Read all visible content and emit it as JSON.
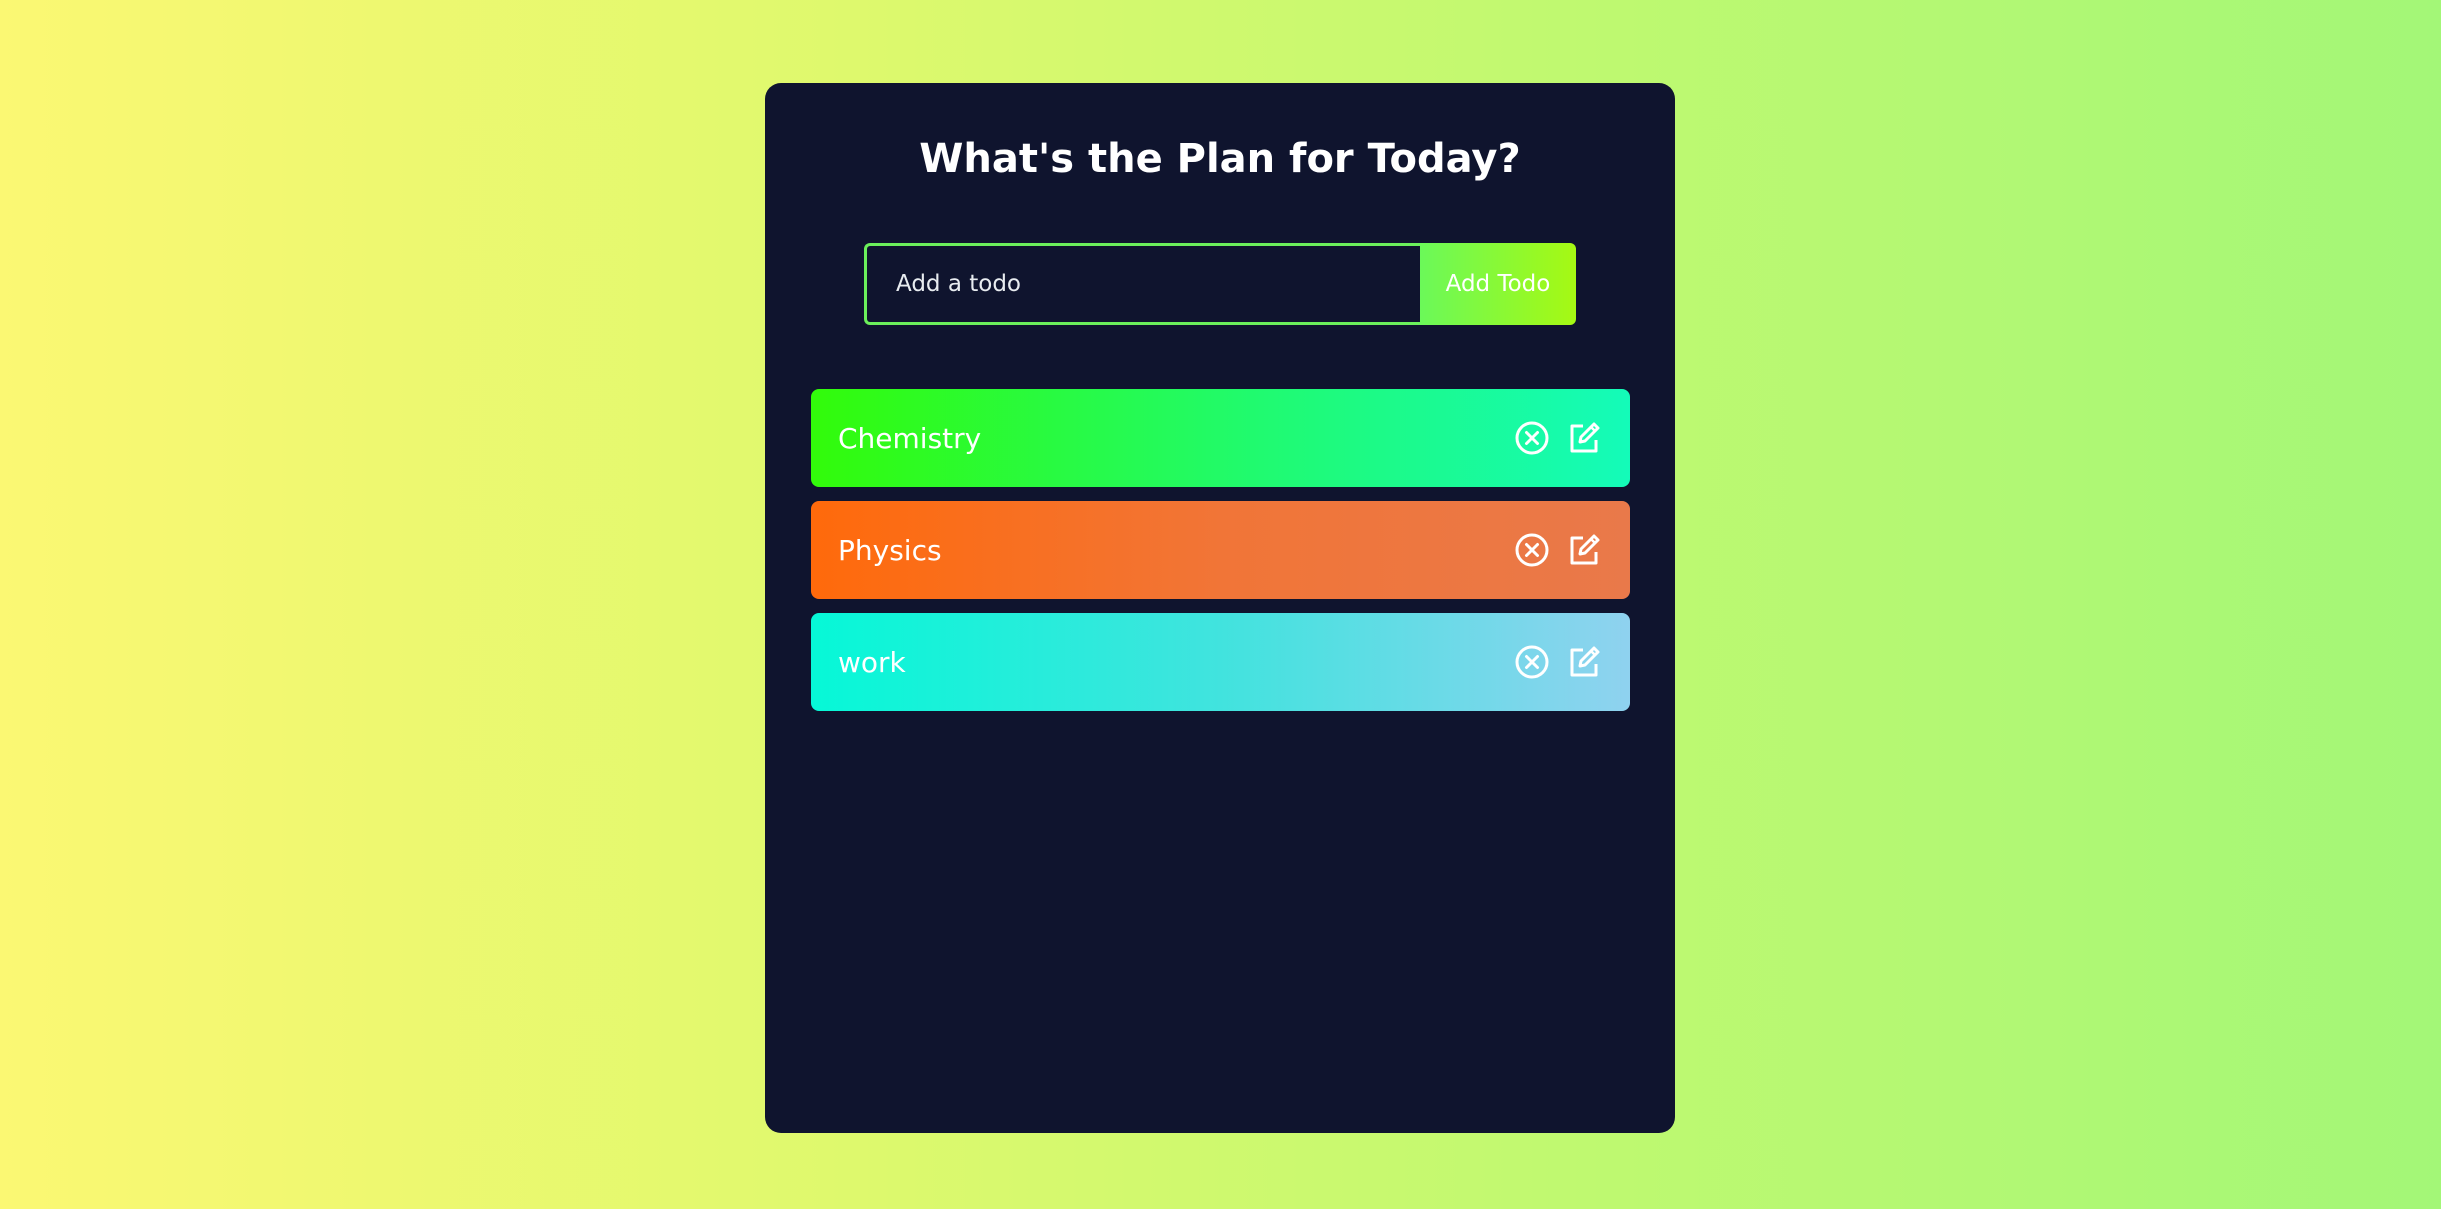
{
  "app": {
    "title": "What's the Plan for Today?"
  },
  "form": {
    "input_placeholder": "Add a todo",
    "input_value": "",
    "button_label": "Add Todo"
  },
  "todos": [
    {
      "text": "Chemistry",
      "delete_icon": "close-circle-icon",
      "edit_icon": "edit-icon",
      "gradient": [
        "#32fb0a",
        "#14fbb9"
      ]
    },
    {
      "text": "Physics",
      "delete_icon": "close-circle-icon",
      "edit_icon": "edit-icon",
      "gradient": [
        "#ff6a0b",
        "#e9794a"
      ]
    },
    {
      "text": "work",
      "delete_icon": "close-circle-icon",
      "edit_icon": "edit-icon",
      "gradient": [
        "#06f8d7",
        "#8fd2ef"
      ]
    }
  ],
  "colors": {
    "card_background": "#0f142e",
    "input_border": "#6bf05b",
    "text": "#ffffff"
  }
}
